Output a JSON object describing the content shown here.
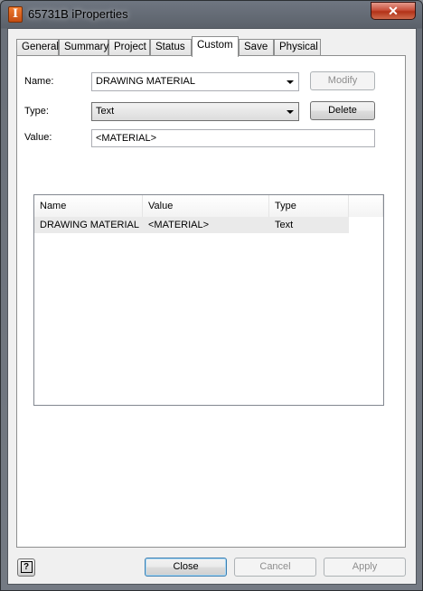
{
  "window": {
    "title": "65731B iProperties",
    "app_icon": "inventor-icon",
    "close_glyph": "✕"
  },
  "tabs": [
    {
      "label": "General"
    },
    {
      "label": "Summary"
    },
    {
      "label": "Project"
    },
    {
      "label": "Status"
    },
    {
      "label": "Custom",
      "active": true
    },
    {
      "label": "Save"
    },
    {
      "label": "Physical"
    }
  ],
  "form": {
    "name_label": "Name:",
    "name_value": "DRAWING MATERIAL",
    "modify_label": "Modify",
    "type_label": "Type:",
    "type_value": "Text",
    "delete_label": "Delete",
    "value_label": "Value:",
    "value_value": "<MATERIAL>"
  },
  "list": {
    "columns": [
      "Name",
      "Value",
      "Type"
    ],
    "rows": [
      {
        "name": "DRAWING MATERIAL",
        "value": "<MATERIAL>",
        "type": "Text"
      }
    ]
  },
  "footer": {
    "help_glyph": "?",
    "close_label": "Close",
    "cancel_label": "Cancel",
    "apply_label": "Apply"
  }
}
